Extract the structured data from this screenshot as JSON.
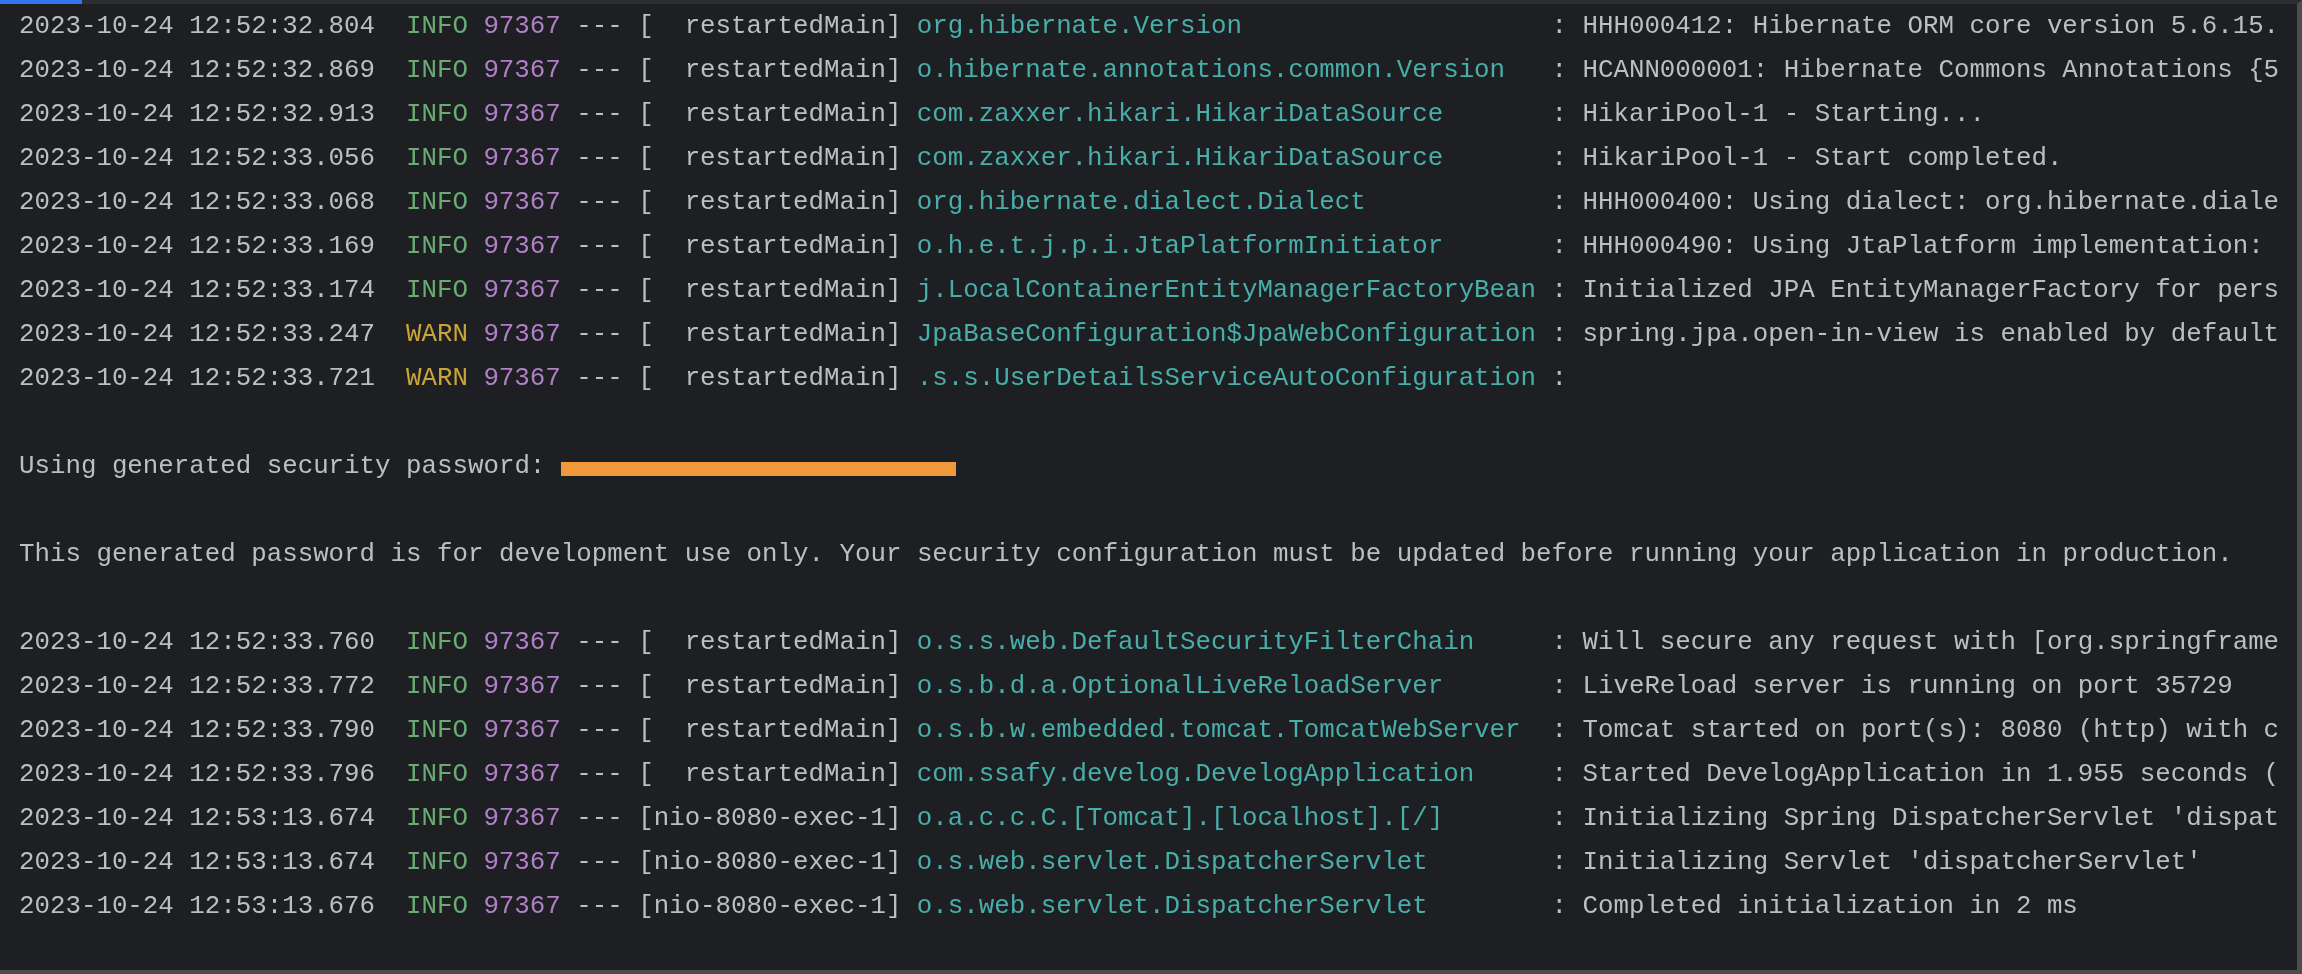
{
  "lines": [
    {
      "kind": "log",
      "timestamp": "2023-10-24 12:52:32.804",
      "level": "INFO",
      "color": "#6aab73",
      "pid": "97367",
      "separator": "---",
      "thread": "[  restartedMain]",
      "logger": "org.hibernate.Version",
      "message": ": HHH000412: Hibernate ORM core version 5.6.15."
    },
    {
      "kind": "log",
      "timestamp": "2023-10-24 12:52:32.869",
      "level": "INFO",
      "color": "#6aab73",
      "pid": "97367",
      "separator": "---",
      "thread": "[  restartedMain]",
      "logger": "o.hibernate.annotations.common.Version",
      "message": ": HCANN000001: Hibernate Commons Annotations {5"
    },
    {
      "kind": "log",
      "timestamp": "2023-10-24 12:52:32.913",
      "level": "INFO",
      "color": "#6aab73",
      "pid": "97367",
      "separator": "---",
      "thread": "[  restartedMain]",
      "logger": "com.zaxxer.hikari.HikariDataSource",
      "message": ": HikariPool-1 - Starting..."
    },
    {
      "kind": "log",
      "timestamp": "2023-10-24 12:52:33.056",
      "level": "INFO",
      "color": "#6aab73",
      "pid": "97367",
      "separator": "---",
      "thread": "[  restartedMain]",
      "logger": "com.zaxxer.hikari.HikariDataSource",
      "message": ": HikariPool-1 - Start completed."
    },
    {
      "kind": "log",
      "timestamp": "2023-10-24 12:52:33.068",
      "level": "INFO",
      "color": "#6aab73",
      "pid": "97367",
      "separator": "---",
      "thread": "[  restartedMain]",
      "logger": "org.hibernate.dialect.Dialect",
      "message": ": HHH000400: Using dialect: org.hibernate.diale"
    },
    {
      "kind": "log",
      "timestamp": "2023-10-24 12:52:33.169",
      "level": "INFO",
      "color": "#6aab73",
      "pid": "97367",
      "separator": "---",
      "thread": "[  restartedMain]",
      "logger": "o.h.e.t.j.p.i.JtaPlatformInitiator",
      "message": ": HHH000490: Using JtaPlatform implementation:"
    },
    {
      "kind": "log",
      "timestamp": "2023-10-24 12:52:33.174",
      "level": "INFO",
      "color": "#6aab73",
      "pid": "97367",
      "separator": "---",
      "thread": "[  restartedMain]",
      "logger": "j.LocalContainerEntityManagerFactoryBean",
      "message": ": Initialized JPA EntityManagerFactory for pers"
    },
    {
      "kind": "log",
      "timestamp": "2023-10-24 12:52:33.247",
      "level": "WARN",
      "color": "#c9a43a",
      "pid": "97367",
      "separator": "---",
      "thread": "[  restartedMain]",
      "logger": "JpaBaseConfiguration$JpaWebConfiguration",
      "message": ": spring.jpa.open-in-view is enabled by default"
    },
    {
      "kind": "log",
      "timestamp": "2023-10-24 12:52:33.721",
      "level": "WARN",
      "color": "#c9a43a",
      "pid": "97367",
      "separator": "---",
      "thread": "[  restartedMain]",
      "logger": ".s.s.UserDetailsServiceAutoConfiguration",
      "message": ":"
    },
    {
      "kind": "text",
      "text": "Using generated security password:",
      "redacted": true
    },
    {
      "kind": "text",
      "text": "This generated password is for development use only. Your security configuration must be updated before running your application in production.",
      "redacted": false
    },
    {
      "kind": "log",
      "timestamp": "2023-10-24 12:52:33.760",
      "level": "INFO",
      "color": "#6aab73",
      "pid": "97367",
      "separator": "---",
      "thread": "[  restartedMain]",
      "logger": "o.s.s.web.DefaultSecurityFilterChain",
      "message": ": Will secure any request with [org.springframe"
    },
    {
      "kind": "log",
      "timestamp": "2023-10-24 12:52:33.772",
      "level": "INFO",
      "color": "#6aab73",
      "pid": "97367",
      "separator": "---",
      "thread": "[  restartedMain]",
      "logger": "o.s.b.d.a.OptionalLiveReloadServer",
      "message": ": LiveReload server is running on port 35729"
    },
    {
      "kind": "log",
      "timestamp": "2023-10-24 12:52:33.790",
      "level": "INFO",
      "color": "#6aab73",
      "pid": "97367",
      "separator": "---",
      "thread": "[  restartedMain]",
      "logger": "o.s.b.w.embedded.tomcat.TomcatWebServer",
      "message": ": Tomcat started on port(s): 8080 (http) with c"
    },
    {
      "kind": "log",
      "timestamp": "2023-10-24 12:52:33.796",
      "level": "INFO",
      "color": "#6aab73",
      "pid": "97367",
      "separator": "---",
      "thread": "[  restartedMain]",
      "logger": "com.ssafy.develog.DevelogApplication",
      "message": ": Started DevelogApplication in 1.955 seconds ("
    },
    {
      "kind": "log",
      "timestamp": "2023-10-24 12:53:13.674",
      "level": "INFO",
      "color": "#6aab73",
      "pid": "97367",
      "separator": "---",
      "thread": "[nio-8080-exec-1]",
      "logger": "o.a.c.c.C.[Tomcat].[localhost].[/]",
      "message": ": Initializing Spring DispatcherServlet 'dispat"
    },
    {
      "kind": "log",
      "timestamp": "2023-10-24 12:53:13.674",
      "level": "INFO",
      "color": "#6aab73",
      "pid": "97367",
      "separator": "---",
      "thread": "[nio-8080-exec-1]",
      "logger": "o.s.web.servlet.DispatcherServlet",
      "message": ": Initializing Servlet 'dispatcherServlet'"
    },
    {
      "kind": "log",
      "timestamp": "2023-10-24 12:53:13.676",
      "level": "INFO",
      "color": "#6aab73",
      "pid": "97367",
      "separator": "---",
      "thread": "[nio-8080-exec-1]",
      "logger": "o.s.web.servlet.DispatcherServlet",
      "message": ": Completed initialization in 2 ms"
    }
  ]
}
